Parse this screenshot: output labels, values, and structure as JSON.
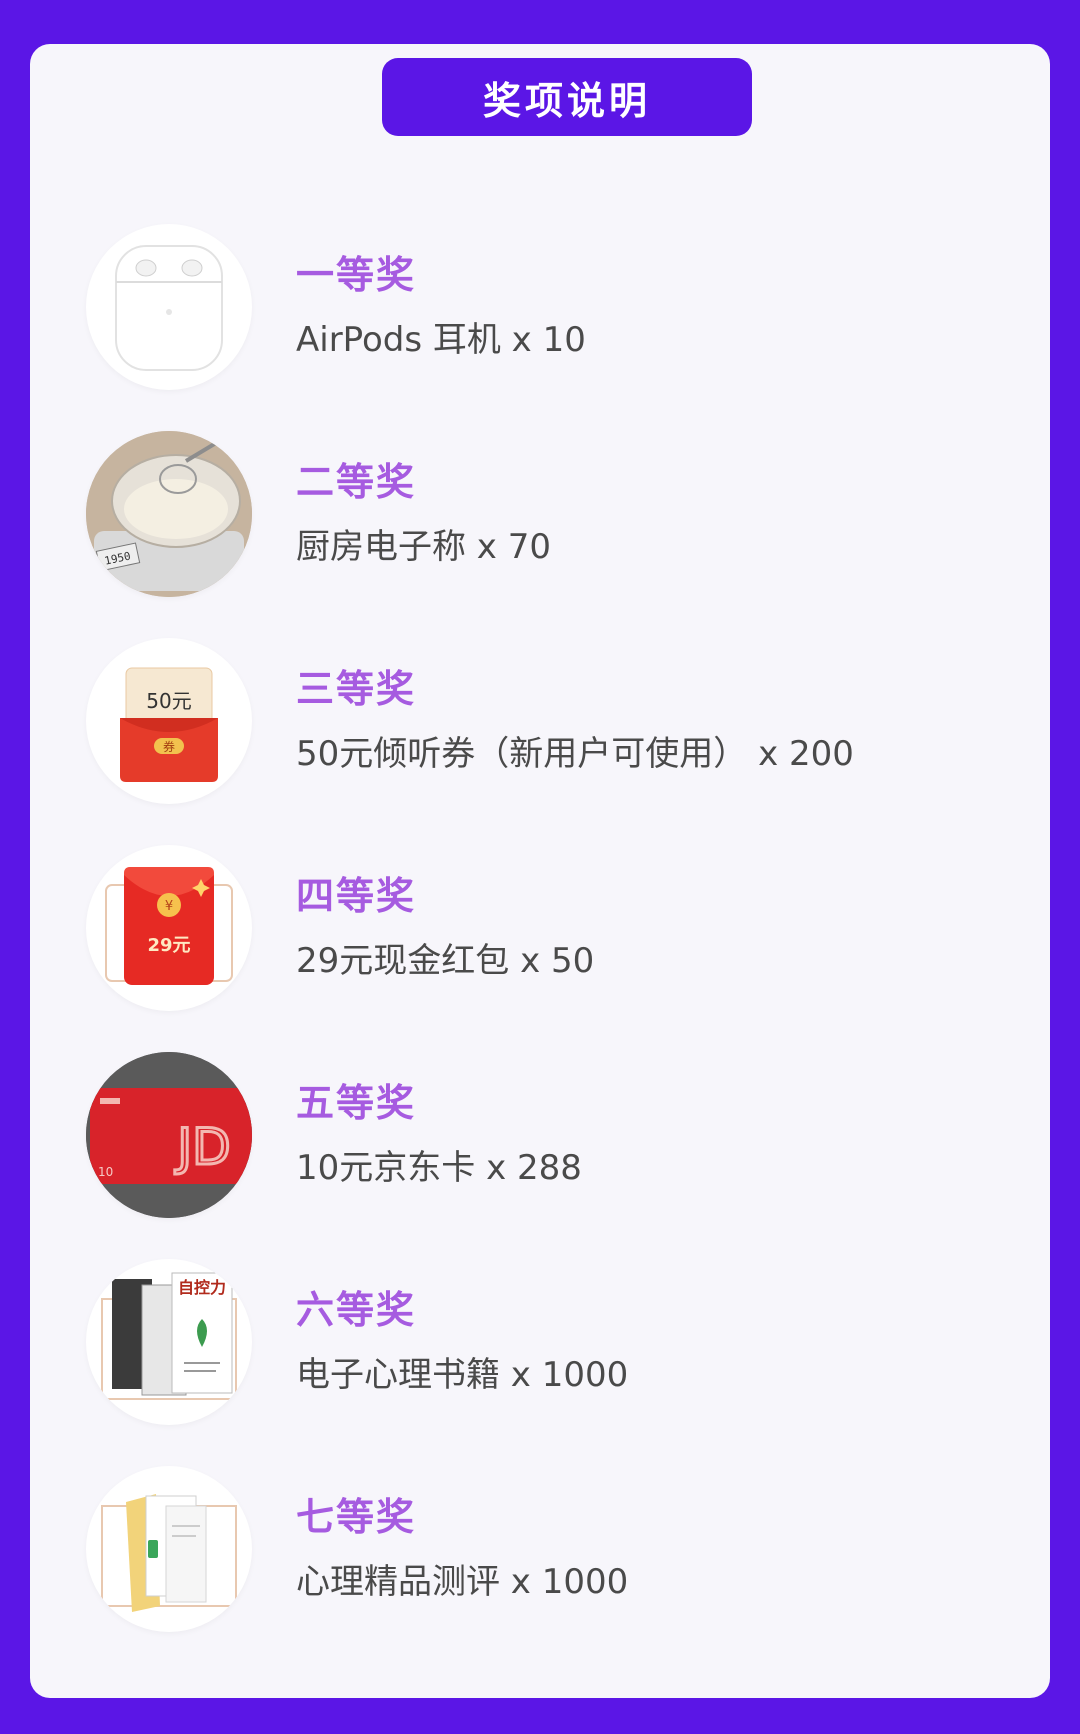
{
  "header": {
    "title": "奖项说明"
  },
  "prizes": [
    {
      "rank": "一等奖",
      "desc": "AirPods 耳机 x 10",
      "icon": "airpods-icon"
    },
    {
      "rank": "二等奖",
      "desc": "厨房电子称 x 70",
      "icon": "kitchen-scale-icon",
      "scale_display": "1950"
    },
    {
      "rank": "三等奖",
      "desc": "50元倾听券（新用户可使用） x 200",
      "icon": "coupon-icon",
      "coupon_amount": "50元",
      "coupon_tag": "券"
    },
    {
      "rank": "四等奖",
      "desc": "29元现金红包 x 50",
      "icon": "red-envelope-icon",
      "envelope_amount": "29元",
      "envelope_symbol": "¥"
    },
    {
      "rank": "五等奖",
      "desc": "10元京东卡 x 288",
      "icon": "jd-card-icon",
      "card_logo": "JD",
      "card_value": "10"
    },
    {
      "rank": "六等奖",
      "desc": "电子心理书籍 x 1000",
      "icon": "books-icon",
      "book_title": "自控力"
    },
    {
      "rank": "七等奖",
      "desc": "心理精品测评 x 1000",
      "icon": "folder-files-icon"
    }
  ],
  "colors": {
    "brand": "#5b16e6",
    "rank": "#a65be0",
    "card": "#f7f6fb",
    "text": "#4a4a4a"
  }
}
